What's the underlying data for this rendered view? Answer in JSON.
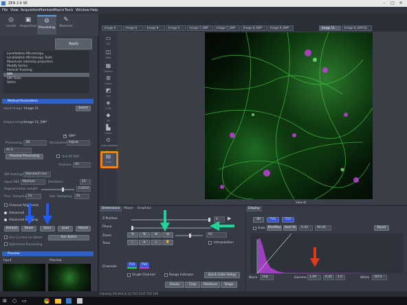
{
  "window": {
    "title": "ZEN 2.6 SE"
  },
  "menu": [
    "File",
    "View",
    "Acquisition",
    "Maintain",
    "Macro",
    "Tools",
    "Window",
    "Help"
  ],
  "left_tabs": [
    {
      "label": "Locate",
      "icon": "locate-icon"
    },
    {
      "label": "Acquisition",
      "icon": "camera-icon"
    },
    {
      "label": "Processing",
      "icon": "gear-icon",
      "active": true
    },
    {
      "label": "Maintain",
      "icon": "wrench-icon"
    }
  ],
  "processing": {
    "apply_label": "Apply",
    "methods": [
      "Localization Microscopy",
      "Localization Microscopy Tools",
      "Maximum intensity projection",
      "Modify Series",
      "Particle Tracking",
      "SIM",
      "SIM Tools",
      "Stitch"
    ],
    "selected_method": "SIM",
    "method_parameters_header": "Method Parameters",
    "use_ry_roi": "Use RY ROI",
    "input_image_label": "Input Image",
    "input_image_value": "Image 11",
    "select_label": "Select",
    "output_image_label": "Output Image",
    "output_image_value": "Image 11_SIM*",
    "sim_label": "SIM*",
    "processing_label": "Processing",
    "processing_value": "3D",
    "parameters_label": "Parameters",
    "parameters_value": "Adjust",
    "all_value": "All 2",
    "preview_processing_label": "Preview Processing",
    "channel_label": "Channel",
    "channel_value": "All",
    "sim_settings_label": "SIM Settings",
    "sim_settings_value": "Standard Live",
    "input_snr_label": "Input SNR",
    "input_snr_value": "Medium",
    "iterations_label": "Iterations",
    "iterations_value": "16",
    "reg_weight_label": "Regularization weight",
    "reg_weight_value": "0.0650",
    "proc_sampling_label": "Proc. Sampling",
    "proc_sampling_value": "2x",
    "out_sampling_label": "Out. Sampling",
    "out_sampling_value": "2x",
    "channel_align_label": "Channel Alignment",
    "advanced_label": "Advanced",
    "advanced_imaging_label": "Advanced Imaging",
    "buttons": [
      "Default",
      "Reset",
      "Save",
      "Load",
      "Attach"
    ],
    "use_current_for_batch": "Use Current for Batch",
    "run_batch": "Run Batch",
    "optimized_processing": "Optimized Processing"
  },
  "preview": {
    "header": "Preview",
    "input_label": "Input",
    "preview_label": "Preview"
  },
  "image_tabs": [
    "Image 6",
    "Image 6",
    "Image 8",
    "Image 5",
    "Image 7_SIM*",
    "Image 7_SIM*",
    "Image 8_SIM*",
    "Image 9_SIM*",
    "Image 11",
    "Image 8_SIM*10"
  ],
  "active_image_tab": "Image 11",
  "view_tools": [
    {
      "label": "2D",
      "icon": "2d-view-icon"
    },
    {
      "label": "Split",
      "icon": "split-view-icon"
    },
    {
      "label": "Gallery",
      "icon": "gallery-icon"
    },
    {
      "label": "Ortho",
      "icon": "ortho-icon"
    },
    {
      "label": "Cut",
      "icon": "cut-icon"
    },
    {
      "label": "2.5D",
      "icon": "2-5d-icon"
    },
    {
      "label": "3D",
      "icon": "3d-icon"
    },
    {
      "label": "Histo",
      "icon": "histogram-icon"
    },
    {
      "label": "Colocalization",
      "icon": "coloc-icon"
    },
    {
      "label": "Profile",
      "icon": "profile-icon"
    },
    {
      "label": "Info",
      "icon": "info-icon",
      "active": true
    }
  ],
  "view_all_label": "View all",
  "dimensions": {
    "tabs": [
      "Dimensions",
      "Player",
      "Graphics"
    ],
    "z_position_label": "Z-Position",
    "z_value": "8",
    "phase_label": "Phase",
    "zoom_label": "Zoom",
    "zoom_value": "93",
    "tools_label": "Tools",
    "interpolation_label": "Interpolation",
    "channels_label": "Channels",
    "channel_buttons": [
      "TV1",
      "TV2"
    ],
    "single_channel": "Single Channel",
    "range_indicator": "Range Indicator",
    "quick_color_setup": "Quick Color Setup",
    "bottom_buttons": [
      "Reuse",
      "Crop",
      "Positions",
      "Stage"
    ]
  },
  "display": {
    "header": "Display",
    "channel_tabs": [
      "All",
      "TV1",
      "TV2"
    ],
    "auto_label": "Auto",
    "min_max_label": "Min/Max",
    "best_fit_label": "Best fit",
    "best_fit_min": "0.40",
    "best_fit_max": "99.00",
    "reset_label": "Reset",
    "black_label": "Black",
    "black_value": "148",
    "gamma_label": "Gamma",
    "gamma_value": "1.00",
    "gamma_a": "0.45",
    "gamma_b": "1.0",
    "white_label": "White",
    "white_value": "3073"
  },
  "status": {
    "text": "Intensity (93,834,3) [1] TV1 5121 TV2 109"
  },
  "colors": {
    "accent": "#2f62c8",
    "highlight": "#f0821e",
    "arrow_blue": "#1e5cff",
    "arrow_green": "#22d39a",
    "arrow_red": "#e03a1c",
    "histogram": "#a040c0"
  }
}
